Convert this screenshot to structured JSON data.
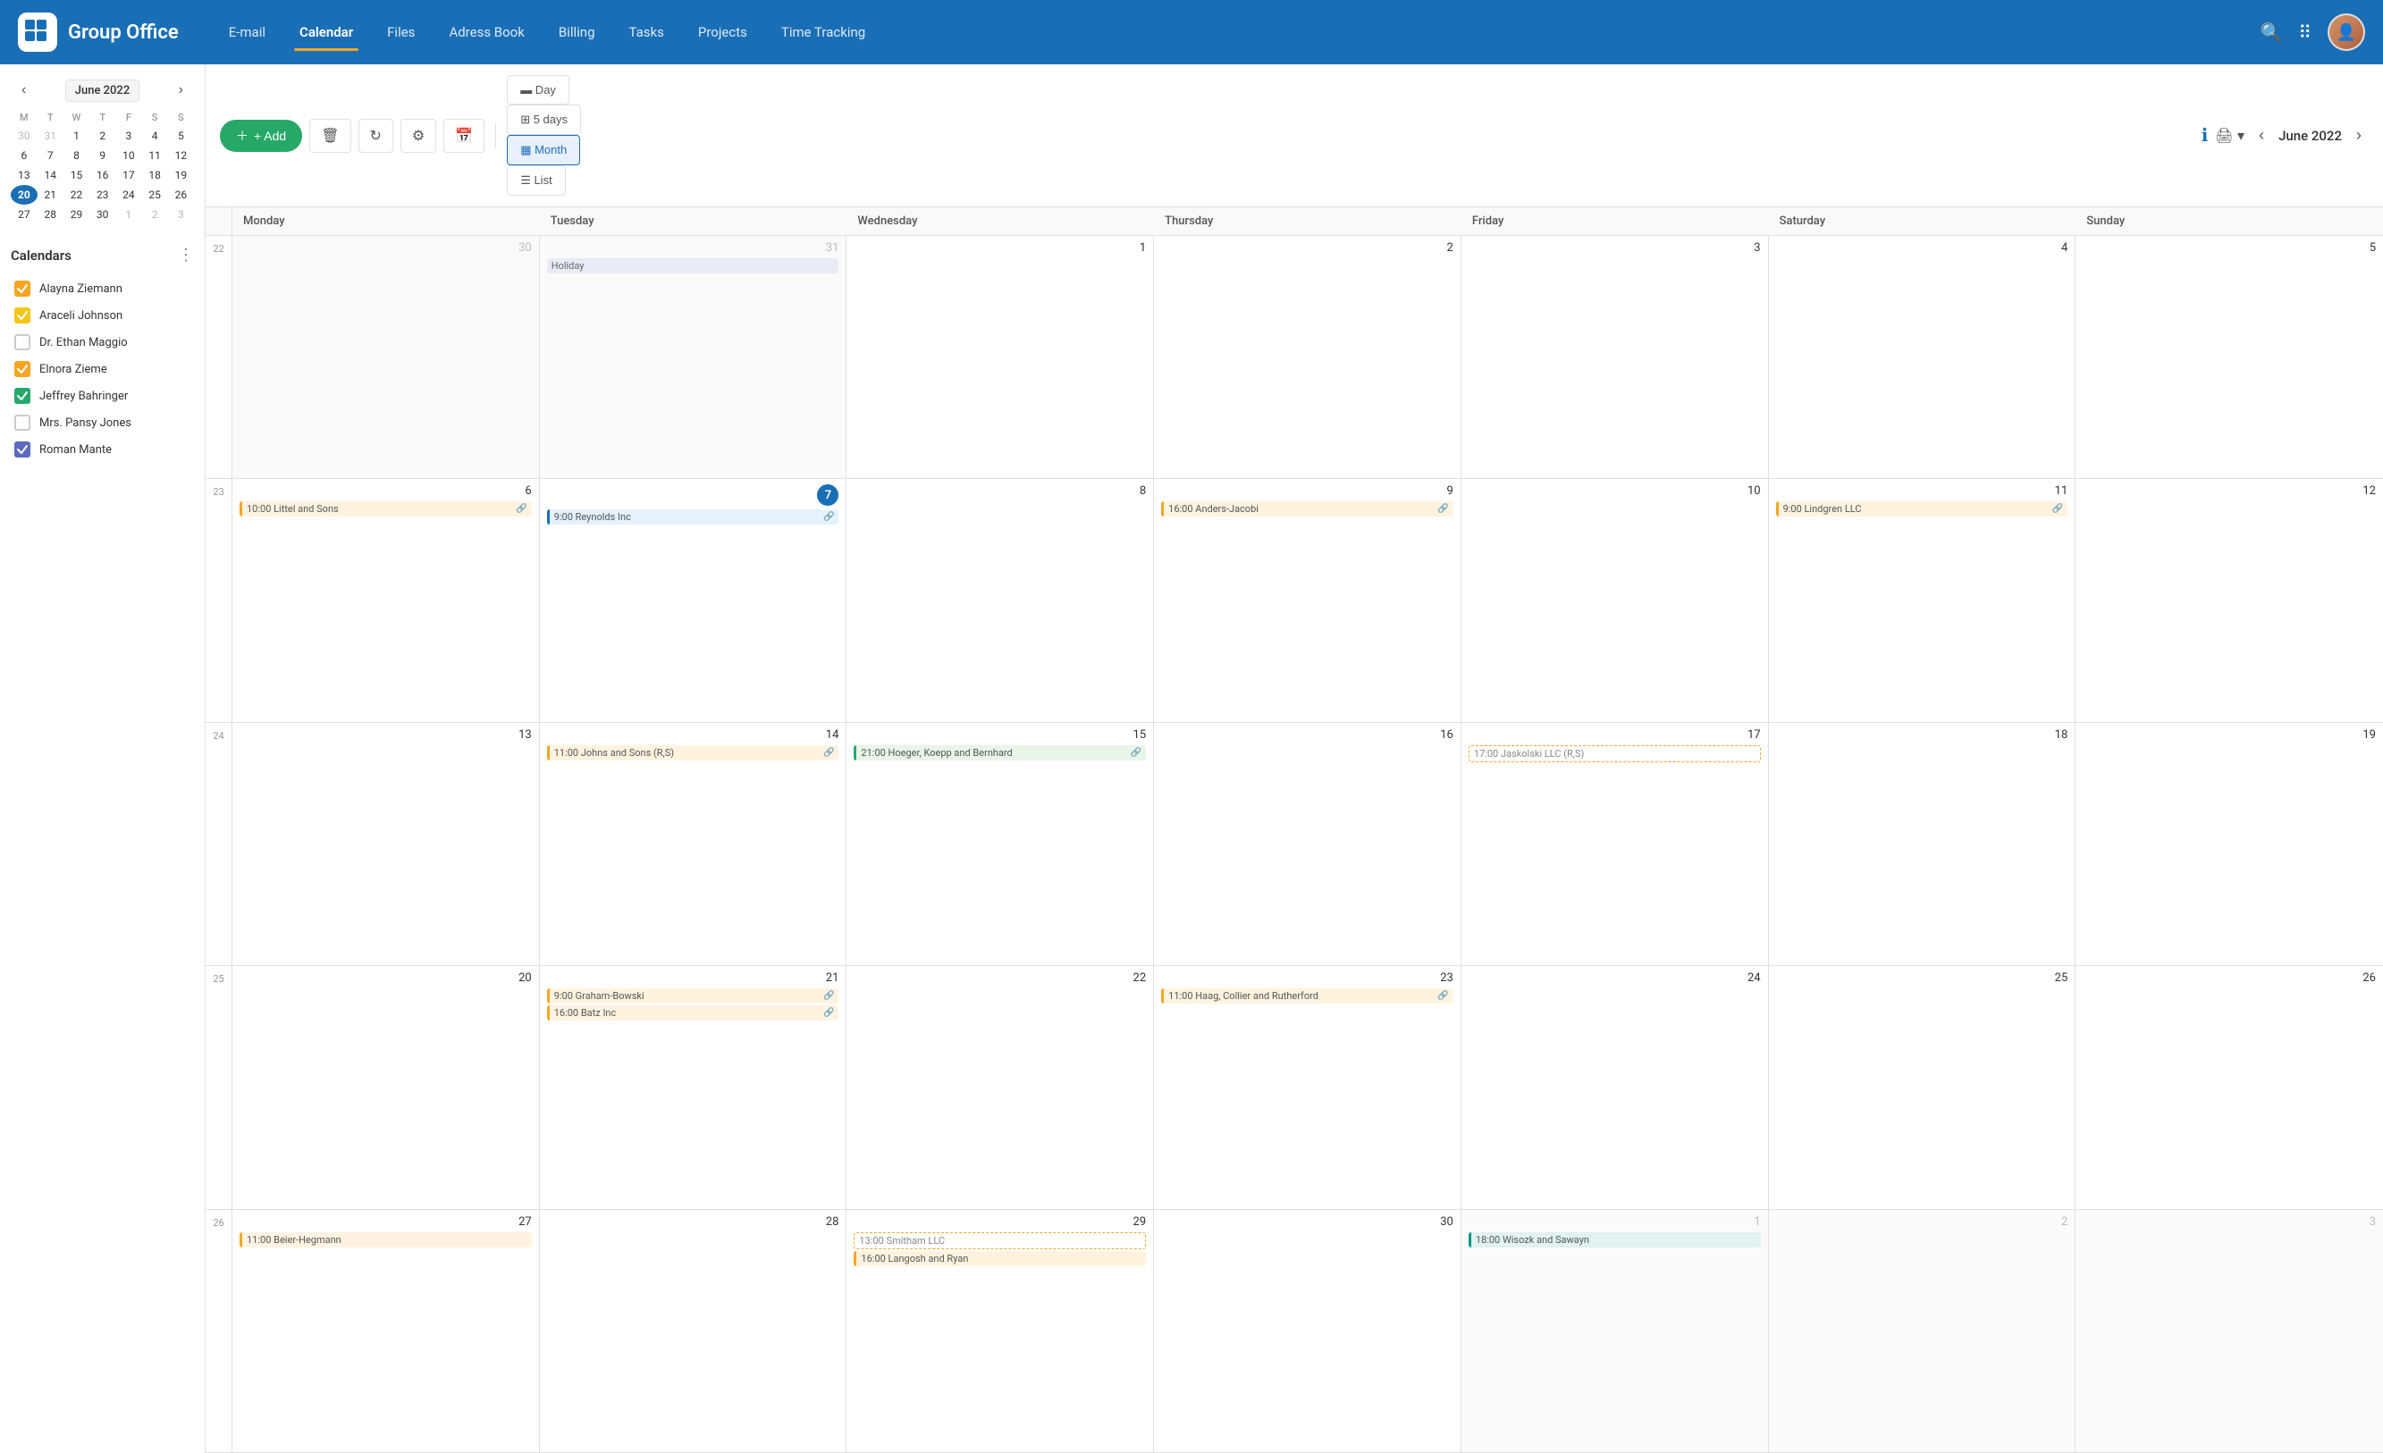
{
  "app": {
    "name": "Group Office"
  },
  "nav": {
    "links": [
      {
        "label": "E-mail",
        "active": false
      },
      {
        "label": "Calendar",
        "active": true
      },
      {
        "label": "Files",
        "active": false
      },
      {
        "label": "Adress Book",
        "active": false
      },
      {
        "label": "Billing",
        "active": false
      },
      {
        "label": "Tasks",
        "active": false
      },
      {
        "label": "Projects",
        "active": false
      },
      {
        "label": "Time Tracking",
        "active": false
      }
    ]
  },
  "sidebar": {
    "mini_cal_month": "June 2022",
    "days_header": [
      "M",
      "T",
      "W",
      "T",
      "F",
      "S",
      "S"
    ],
    "weeks": [
      {
        "num": "",
        "days": [
          {
            "n": "30",
            "other": true
          },
          {
            "n": "31",
            "other": true
          },
          {
            "n": "1",
            "other": false
          },
          {
            "n": "2",
            "other": false
          },
          {
            "n": "3",
            "other": false
          },
          {
            "n": "4",
            "other": false
          },
          {
            "n": "5",
            "other": false
          }
        ]
      },
      {
        "num": "",
        "days": [
          {
            "n": "6",
            "other": false
          },
          {
            "n": "7",
            "other": false
          },
          {
            "n": "8",
            "other": false
          },
          {
            "n": "9",
            "other": false
          },
          {
            "n": "10",
            "other": false
          },
          {
            "n": "11",
            "other": false
          },
          {
            "n": "12",
            "other": false
          }
        ]
      },
      {
        "num": "",
        "days": [
          {
            "n": "13",
            "other": false
          },
          {
            "n": "14",
            "other": false
          },
          {
            "n": "15",
            "other": false
          },
          {
            "n": "16",
            "other": false
          },
          {
            "n": "17",
            "other": false
          },
          {
            "n": "18",
            "other": false
          },
          {
            "n": "19",
            "other": false
          }
        ]
      },
      {
        "num": "",
        "days": [
          {
            "n": "20",
            "other": false,
            "today": true
          },
          {
            "n": "21",
            "other": false
          },
          {
            "n": "22",
            "other": false
          },
          {
            "n": "23",
            "other": false
          },
          {
            "n": "24",
            "other": false
          },
          {
            "n": "25",
            "other": false
          },
          {
            "n": "26",
            "other": false
          }
        ]
      },
      {
        "num": "",
        "days": [
          {
            "n": "27",
            "other": false
          },
          {
            "n": "28",
            "other": false
          },
          {
            "n": "29",
            "other": false
          },
          {
            "n": "30",
            "other": false
          },
          {
            "n": "1",
            "other": true
          },
          {
            "n": "2",
            "other": true
          },
          {
            "n": "3",
            "other": true
          }
        ]
      }
    ],
    "calendars_title": "Calendars",
    "calendars": [
      {
        "name": "Alayna Ziemann",
        "checked": true,
        "color": "#f5a623"
      },
      {
        "name": "Araceli Johnson",
        "checked": true,
        "color": "#f5c518"
      },
      {
        "name": "Dr. Ethan Maggio",
        "checked": false,
        "color": "#ccc"
      },
      {
        "name": "Elnora Zieme",
        "checked": true,
        "color": "#f5a623"
      },
      {
        "name": "Jeffrey Bahringer",
        "checked": true,
        "color": "#26a869"
      },
      {
        "name": "Mrs. Pansy Jones",
        "checked": false,
        "color": "#ccc"
      },
      {
        "name": "Roman Mante",
        "checked": true,
        "color": "#5c6bc0"
      }
    ]
  },
  "toolbar": {
    "add_label": "+ Add",
    "views": [
      {
        "label": "Day",
        "active": false
      },
      {
        "label": "5 days",
        "active": false
      },
      {
        "label": "Month",
        "active": true
      },
      {
        "label": "List",
        "active": false
      }
    ],
    "current_month": "June 2022"
  },
  "calendar": {
    "day_headers": [
      "Monday",
      "Tuesday",
      "Wednesday",
      "Thursday",
      "Friday",
      "Saturday",
      "Sunday"
    ],
    "weeks": [
      {
        "week_num": "22",
        "days": [
          {
            "n": "30",
            "other": true,
            "events": []
          },
          {
            "n": "31",
            "other": true,
            "events": [
              {
                "label": "Holiday",
                "color": "holiday"
              }
            ]
          },
          {
            "n": "1",
            "events": []
          },
          {
            "n": "2",
            "events": []
          },
          {
            "n": "3",
            "events": []
          },
          {
            "n": "4",
            "events": []
          },
          {
            "n": "5",
            "events": []
          }
        ]
      },
      {
        "week_num": "23",
        "days": [
          {
            "n": "6",
            "events": [
              {
                "label": "10:00 Littel and Sons",
                "color": "orange",
                "link": true
              }
            ]
          },
          {
            "n": "7",
            "today": true,
            "events": [
              {
                "label": "9:00 Reynolds Inc",
                "color": "blue",
                "link": true
              }
            ]
          },
          {
            "n": "8",
            "events": []
          },
          {
            "n": "9",
            "events": [
              {
                "label": "16:00 Anders-Jacobi",
                "color": "orange",
                "link": true
              }
            ]
          },
          {
            "n": "10",
            "events": []
          },
          {
            "n": "11",
            "events": [
              {
                "label": "9:00 Lindgren LLC",
                "color": "orange",
                "link": true
              }
            ]
          },
          {
            "n": "12",
            "events": []
          }
        ]
      },
      {
        "week_num": "24",
        "days": [
          {
            "n": "13",
            "events": []
          },
          {
            "n": "14",
            "events": [
              {
                "label": "11:00 Johns and Sons (R,S)",
                "color": "orange",
                "link": true
              }
            ]
          },
          {
            "n": "15",
            "events": [
              {
                "label": "21:00 Hoeger, Koepp and Bernhard",
                "color": "green",
                "link": true
              }
            ]
          },
          {
            "n": "16",
            "events": []
          },
          {
            "n": "17",
            "events": [
              {
                "label": "17:00 Jaskolski LLC (R,S)",
                "color": "yellow-dashed"
              }
            ]
          },
          {
            "n": "18",
            "events": []
          },
          {
            "n": "19",
            "events": []
          }
        ]
      },
      {
        "week_num": "25",
        "days": [
          {
            "n": "20",
            "events": []
          },
          {
            "n": "21",
            "events": [
              {
                "label": "9:00 Graham-Bowski",
                "color": "orange",
                "link": true
              },
              {
                "label": "16:00 Batz Inc",
                "color": "orange",
                "link": true
              }
            ]
          },
          {
            "n": "22",
            "events": []
          },
          {
            "n": "23",
            "events": [
              {
                "label": "11:00 Haag, Collier and Rutherford",
                "color": "orange",
                "link": true
              }
            ]
          },
          {
            "n": "24",
            "events": []
          },
          {
            "n": "25",
            "events": []
          },
          {
            "n": "26",
            "events": []
          }
        ]
      },
      {
        "week_num": "26",
        "days": [
          {
            "n": "27",
            "events": [
              {
                "label": "11:00 Beier-Hegmann",
                "color": "orange",
                "link": false
              }
            ]
          },
          {
            "n": "28",
            "events": []
          },
          {
            "n": "29",
            "events": [
              {
                "label": "13:00 Smitham LLC",
                "color": "yellow-dashed"
              },
              {
                "label": "16:00 Langosh and Ryan",
                "color": "orange",
                "link": false
              }
            ]
          },
          {
            "n": "30",
            "events": []
          },
          {
            "n": "1",
            "other": true,
            "events": [
              {
                "label": "18:00 Wisozk and Sawayn",
                "color": "teal"
              }
            ]
          },
          {
            "n": "2",
            "other": true,
            "events": []
          },
          {
            "n": "3",
            "other": true,
            "events": []
          }
        ]
      }
    ]
  }
}
